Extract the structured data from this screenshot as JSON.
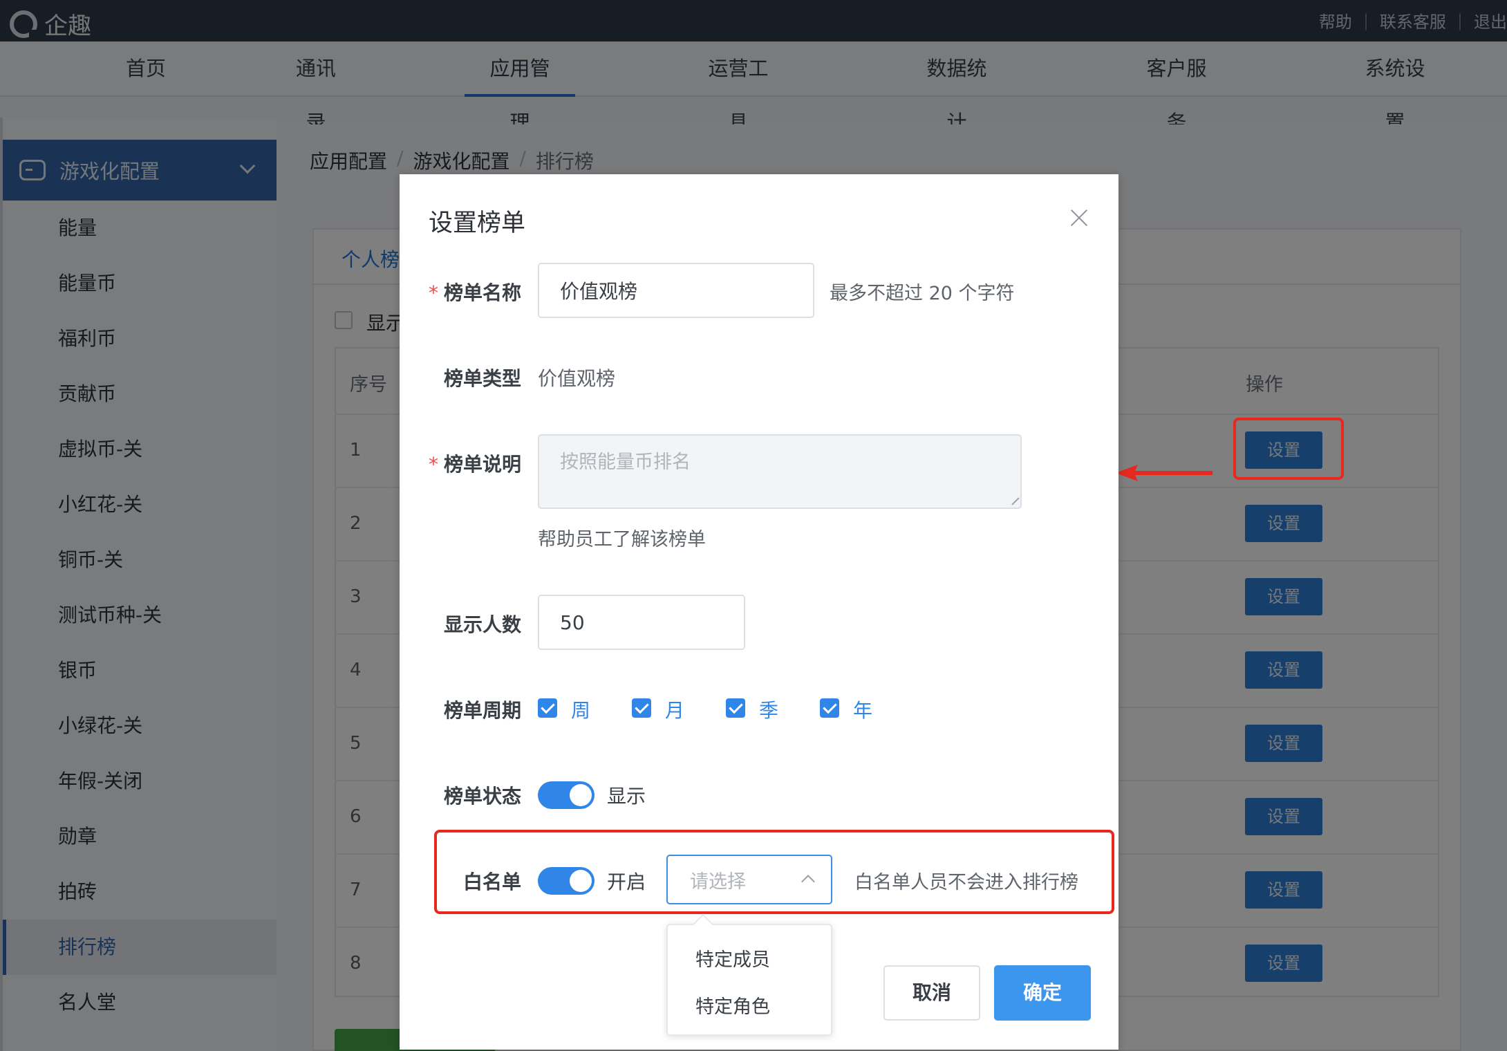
{
  "app": {
    "brand": "企趣"
  },
  "top_links": [
    "帮助",
    "联系客服",
    "退出"
  ],
  "nav": [
    "首页",
    "通讯录",
    "应用管理",
    "运营工具",
    "数据统计",
    "客户服务",
    "系统设置"
  ],
  "sidebar": {
    "group": "游戏化配置",
    "items": [
      "能量",
      "能量币",
      "福利币",
      "贡献币",
      "虚拟币-关",
      "小红花-关",
      "铜币-关",
      "测试币种-关",
      "银币",
      "小绿花-关",
      "年假-关闭",
      "勋章",
      "拍砖",
      "排行榜",
      "名人堂"
    ],
    "active": "排行榜"
  },
  "breadcrumb": [
    "应用配置",
    "游戏化配置",
    "排行榜"
  ],
  "page": {
    "tab_personal": "个人榜",
    "show_checkbox_label": "显示",
    "table_header_index": "序号",
    "table_header_action": "操作",
    "rows": [
      "1",
      "2",
      "3",
      "4",
      "5",
      "6",
      "7",
      "8"
    ],
    "set_label": "设置"
  },
  "dialog": {
    "title": "设置榜单",
    "name_label": "榜单名称",
    "name_value": "价值观榜",
    "name_hint": "最多不超过 20 个字符",
    "type_label": "榜单类型",
    "type_value": "价值观榜",
    "desc_label": "榜单说明",
    "desc_placeholder": "按照能量币排名",
    "desc_hint": "帮助员工了解该榜单",
    "count_label": "显示人数",
    "count_value": "50",
    "period_label": "榜单周期",
    "periods": [
      "周",
      "月",
      "季",
      "年"
    ],
    "status_label": "榜单状态",
    "status_value": "显示",
    "whitelist_label": "白名单",
    "whitelist_value": "开启",
    "select_placeholder": "请选择",
    "whitelist_hint": "白名单人员不会进入排行榜",
    "options": [
      "特定成员",
      "特定角色"
    ],
    "cancel": "取消",
    "confirm": "确定"
  },
  "colors": {
    "primary": "#2f86e8",
    "highlight": "#e8281e",
    "topbar": "#2d3a4b",
    "sidebar_active": "#3566a8"
  }
}
